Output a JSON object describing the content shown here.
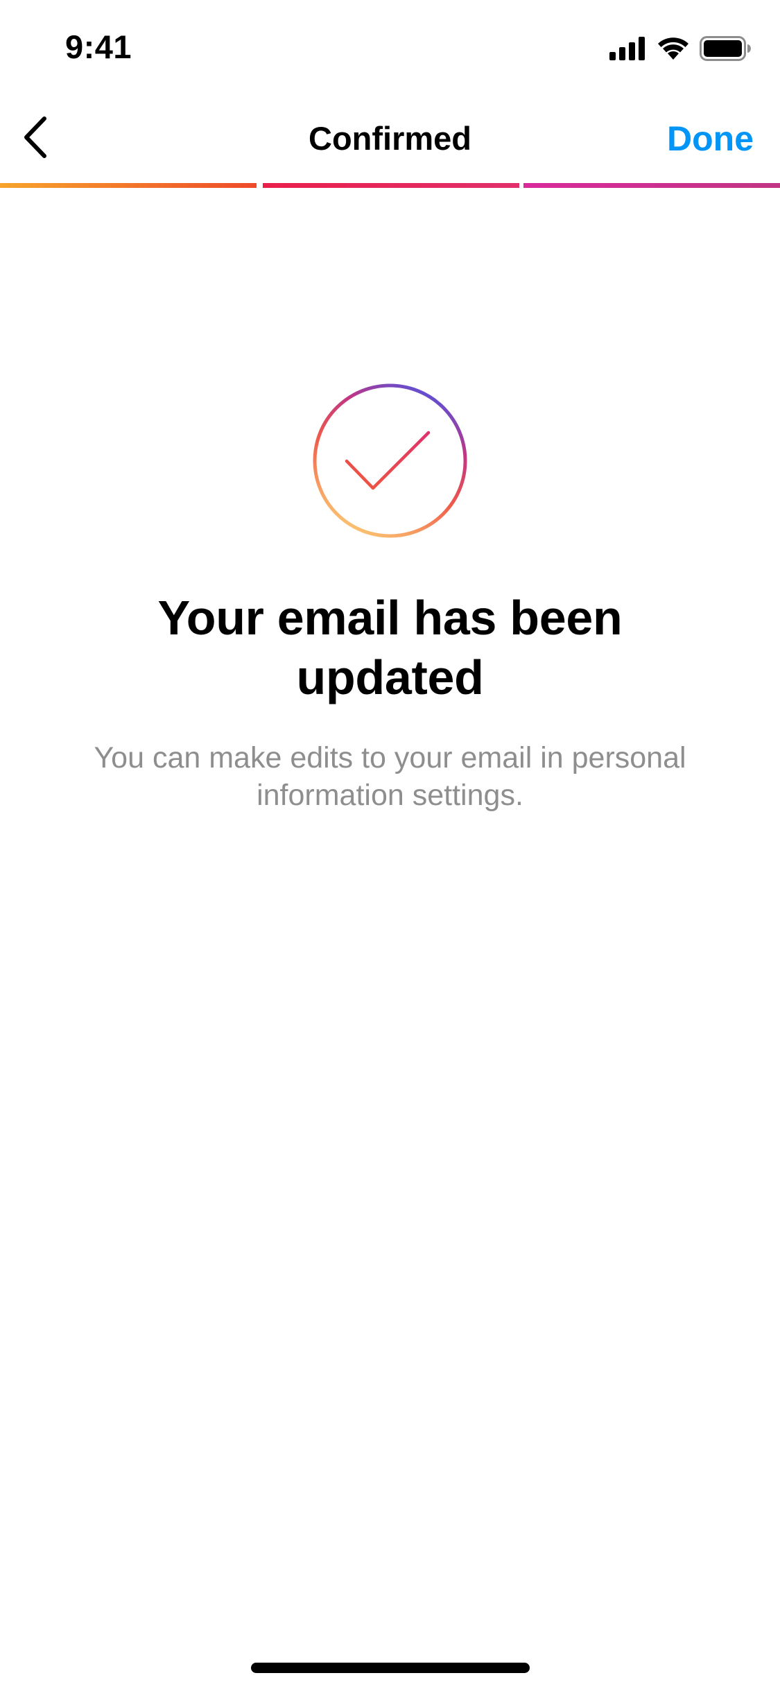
{
  "colors": {
    "text_primary": "#000000",
    "text_secondary": "#8e8e8e",
    "accent_blue": "#0095f6",
    "gradient_orange": "#f7a42c",
    "gradient_red": "#e1306c",
    "gradient_magenta": "#c13584",
    "gradient_purple": "#5b51d8",
    "gradient_yellow": "#fcd077"
  },
  "status_bar": {
    "time": "9:41",
    "icons": [
      "cellular-signal-icon",
      "wifi-icon",
      "battery-icon"
    ]
  },
  "nav": {
    "back_icon": "chevron-left-icon",
    "title": "Confirmed",
    "done_label": "Done"
  },
  "progress": {
    "total_steps": 3,
    "completed_steps": 3
  },
  "content": {
    "badge_icon": "checkmark-circle-icon",
    "headline": "Your email has been updated",
    "subtext": "You can make edits to your email in personal information settings."
  }
}
